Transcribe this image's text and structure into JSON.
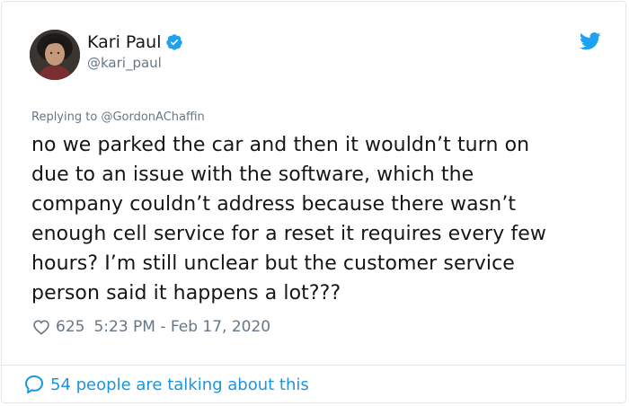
{
  "author": {
    "name": "Kari Paul",
    "handle": "@kari_paul",
    "verified": true
  },
  "reply": {
    "prefix": "Replying to",
    "mention": "@GordonAChaffin"
  },
  "tweet": {
    "lines": [
      "no we parked the car and then it wouldn’t turn on",
      "due to an issue with the software, which the",
      "company couldn’t address because there wasn’t",
      "enough cell service for a reset it requires every few",
      "hours? I’m still unclear but the customer service",
      "person said it happens a lot???"
    ]
  },
  "meta": {
    "likes": "625",
    "timestamp": "5:23 PM - Feb 17, 2020"
  },
  "footer": {
    "talking": "54 people are talking about this"
  },
  "colors": {
    "accent": "#1da1f2",
    "link": "#1b95e0",
    "muted": "#657786",
    "text": "#14171a",
    "border": "#e1e8ed"
  },
  "icons": {
    "verified": "verified-badge-icon",
    "platform": "twitter-bird-icon",
    "like": "heart-icon",
    "talk": "speech-bubble-icon"
  }
}
